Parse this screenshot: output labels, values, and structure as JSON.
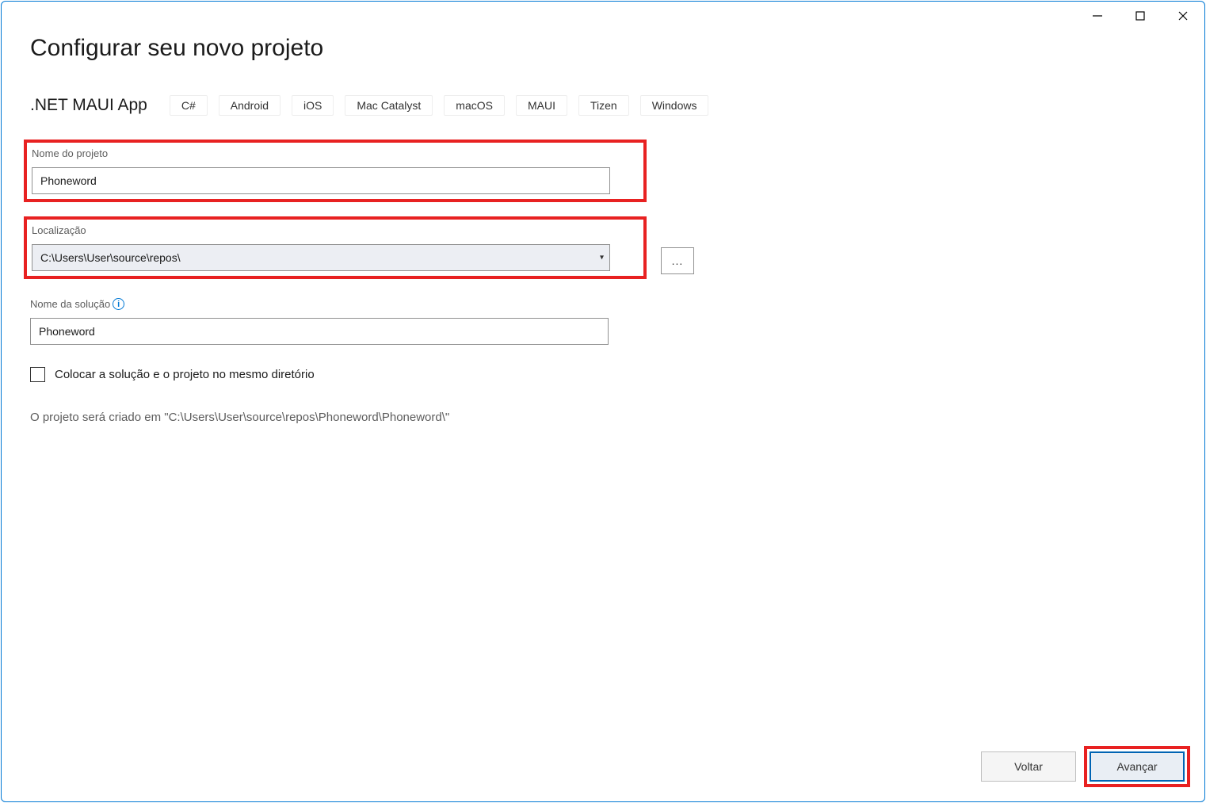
{
  "window": {
    "title": "Configurar seu novo projeto"
  },
  "template": {
    "name": ".NET MAUI App",
    "tags": [
      "C#",
      "Android",
      "iOS",
      "Mac Catalyst",
      "macOS",
      "MAUI",
      "Tizen",
      "Windows"
    ]
  },
  "form": {
    "projectName": {
      "label": "Nome do projeto",
      "value": "Phoneword"
    },
    "location": {
      "label": "Localização",
      "value": "C:\\Users\\User\\source\\repos\\",
      "browseLabel": "..."
    },
    "solutionName": {
      "label": "Nome da solução",
      "value": "Phoneword"
    },
    "sameDirectory": {
      "label": "Colocar a solução e o projeto no mesmo diretório",
      "checked": false
    },
    "pathText": "O projeto será criado em \"C:\\Users\\User\\source\\repos\\Phoneword\\Phoneword\\\""
  },
  "footer": {
    "back": "Voltar",
    "next": "Avançar"
  }
}
